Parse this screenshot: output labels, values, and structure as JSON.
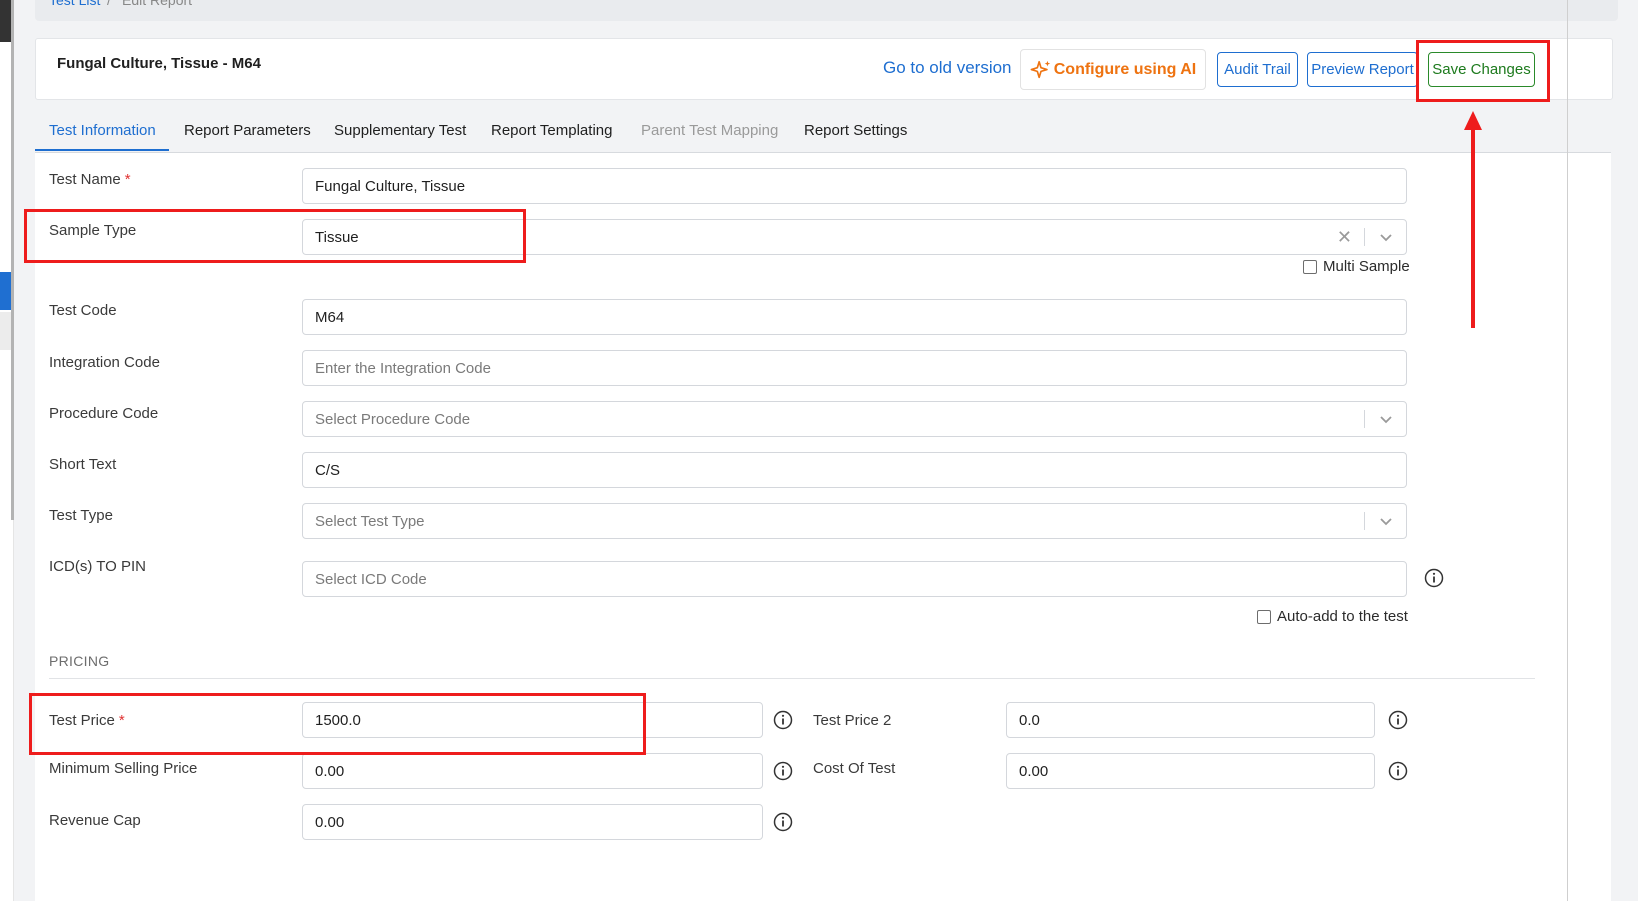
{
  "breadcrumb": {
    "parent": "Test List",
    "separator": "/",
    "current": "Edit Report"
  },
  "header": {
    "title": "Fungal Culture, Tissue - M64",
    "old_version_link": "Go to old version",
    "ai_button": "Configure using AI",
    "audit_button": "Audit Trail",
    "preview_button": "Preview Report",
    "save_button": "Save Changes"
  },
  "tabs": [
    {
      "label": "Test Information",
      "state": "active"
    },
    {
      "label": "Report Parameters",
      "state": "normal"
    },
    {
      "label": "Supplementary Test",
      "state": "normal"
    },
    {
      "label": "Report Templating",
      "state": "normal"
    },
    {
      "label": "Parent Test Mapping",
      "state": "disabled"
    },
    {
      "label": "Report Settings",
      "state": "normal"
    }
  ],
  "form": {
    "test_name": {
      "label": "Test Name",
      "required_mark": "*",
      "value": "Fungal Culture, Tissue"
    },
    "sample_type": {
      "label": "Sample Type",
      "value": "Tissue",
      "clear_glyph": "✕",
      "multi_sample_label": "Multi Sample",
      "multi_sample_checked": false
    },
    "test_code": {
      "label": "Test Code",
      "value": "M64"
    },
    "integration_code": {
      "label": "Integration Code",
      "placeholder": "Enter the Integration Code"
    },
    "procedure_code": {
      "label": "Procedure Code",
      "placeholder": "Select Procedure Code"
    },
    "short_text": {
      "label": "Short Text",
      "value": "C/S"
    },
    "test_type": {
      "label": "Test Type",
      "placeholder": "Select Test Type"
    },
    "icd_to_pin": {
      "label": "ICD(s) TO PIN",
      "placeholder": "Select ICD Code",
      "auto_add_label": "Auto-add to the test",
      "auto_add_checked": false
    }
  },
  "pricing": {
    "section_title": "PRICING",
    "test_price": {
      "label": "Test Price",
      "required_mark": "*",
      "value": "1500.0"
    },
    "test_price_2": {
      "label": "Test Price 2",
      "value": "0.0"
    },
    "minimum_selling_price": {
      "label": "Minimum Selling Price",
      "value": "0.00"
    },
    "cost_of_test": {
      "label": "Cost Of Test",
      "value": "0.00"
    },
    "revenue_cap": {
      "label": "Revenue Cap",
      "value": "0.00"
    }
  },
  "icons": [
    "sparkle-icon",
    "chevron-down-icon",
    "close-icon",
    "info-icon",
    "arrow-up-icon"
  ],
  "colors": {
    "accent_blue": "#1e6ed0",
    "ai_orange": "#ee7311",
    "save_green": "#2a8a2a",
    "required_red": "#e03131",
    "annotation_red": "#ee1c1c"
  }
}
